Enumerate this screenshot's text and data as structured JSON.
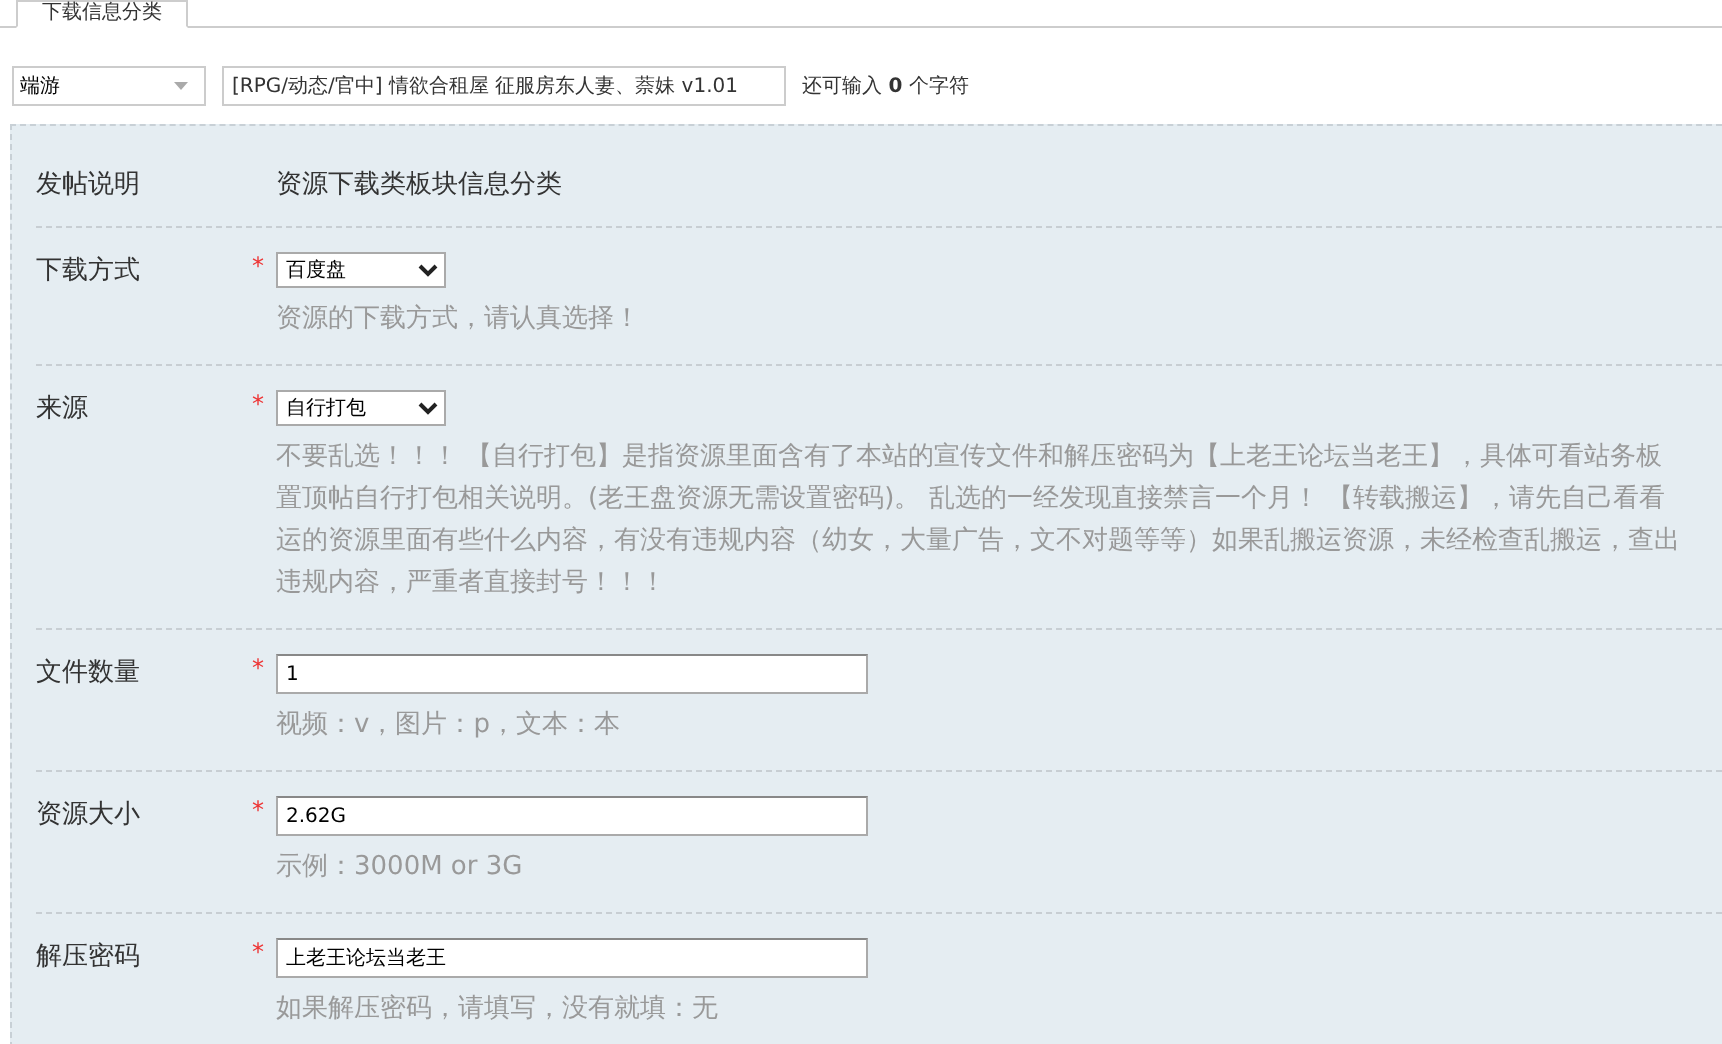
{
  "tab": {
    "label": "下载信息分类",
    "selected": true
  },
  "type_select": {
    "value": "端游"
  },
  "title_field": {
    "value": "[RPG/动态/官中] 情欲合租屋 征服房东人妻、萘妹 v1.01"
  },
  "counter": {
    "prefix": "还可输入",
    "count": "0",
    "suffix": "个字符"
  },
  "rows": [
    {
      "kind": "info",
      "label": "发帖说明",
      "text": "资源下载类板块信息分类"
    },
    {
      "kind": "select",
      "label": "下载方式",
      "required_mark": "*",
      "value": "百度盘",
      "hint_lines": [
        "资源的下载方式，请认真选择！"
      ]
    },
    {
      "kind": "select",
      "label": "来源",
      "required_mark": "*",
      "value": "自行打包",
      "hint_lines": [
        "不要乱选！！！ 【自行打包】是指资源里面含有了本站的宣传文件和解压密码为【上老王论坛当老王】，具体可看站务板",
        "置顶帖自行打包相关说明。(老王盘资源无需设置密码)。 乱选的一经发现直接禁言一个月！ 【转载搬运】，请先自己看看",
        "运的资源里面有些什么内容，有没有违规内容（幼女，大量广告，文不对题等等）如果乱搬运资源，未经检查乱搬运，查出",
        "违规内容，严重者直接封号！！！"
      ]
    },
    {
      "kind": "text",
      "label": "文件数量",
      "required_mark": "*",
      "value": "1",
      "hint_lines": [
        "视频：v，图片：p，文本：本"
      ]
    },
    {
      "kind": "text",
      "label": "资源大小",
      "required_mark": "*",
      "value": "2.62G",
      "hint_lines": [
        "示例：3000M or 3G"
      ]
    },
    {
      "kind": "text",
      "label": "解压密码",
      "required_mark": "*",
      "value": "上老王论坛当老王",
      "hint_lines": [
        "如果解压密码，请填写，没有就填：无"
      ]
    }
  ]
}
